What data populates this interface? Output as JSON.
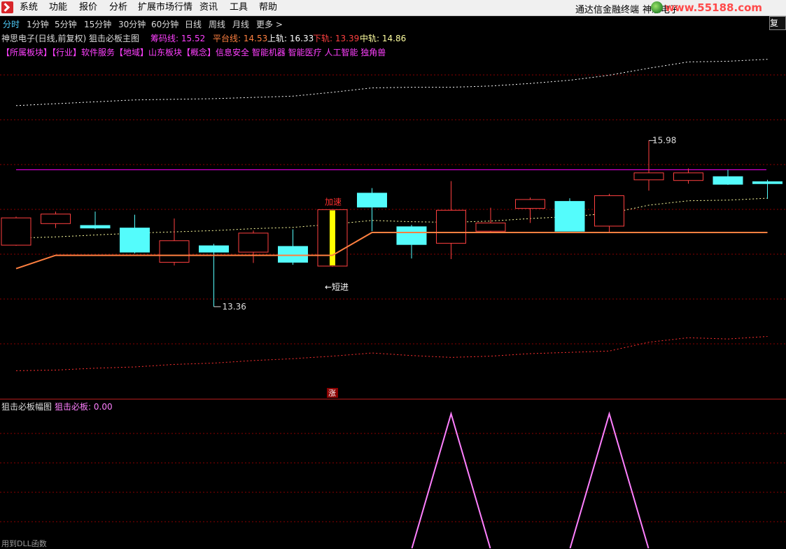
{
  "menu": {
    "items": [
      "系统",
      "功能",
      "报价",
      "分析",
      "扩展市场行情",
      "资讯",
      "工具",
      "帮助"
    ],
    "terminal_name": "通达信金融终端",
    "stock_name": "神思电子",
    "watermark": "www.55188.com"
  },
  "periods": {
    "tabs": [
      "分时",
      "1分钟",
      "5分钟",
      "15分钟",
      "30分钟",
      "60分钟",
      "日线",
      "周线",
      "月线",
      "更多 >"
    ],
    "active": "分时",
    "fuquan_label": "复权"
  },
  "main_title": {
    "stock": "神思电子(日线,前复权) 狙击必板主图",
    "chouma_label": "筹码线:",
    "chouma_value": "15.52",
    "pingtai_label": "平台线:",
    "pingtai_value": "14.53",
    "shangui_label": "上轨:",
    "shangui_value": "16.33",
    "xiagui_label": "下轨:",
    "xiagui_value": "13.39",
    "zhonggui_label": "中轨:",
    "zhonggui_value": "14.86"
  },
  "sectors": "【所属板块】【行业】软件服务【地域】山东板块【概念】信息安全 智能机器 智能医疗 人工智能 独角兽",
  "annotations": {
    "jiasu": "加速",
    "duanjin": "←短进",
    "high_label": "15.98",
    "low_label": "13.36",
    "zhang": "涨"
  },
  "sub_title": {
    "name": "狙击必板幅图",
    "label": "狙击必板:",
    "value": "0.00"
  },
  "bottom_text": "用到DLL函数",
  "colors": {
    "up": "#ff4040",
    "down": "#54fcfc",
    "platform": "#ff8040",
    "chip_line": "#ff00ff",
    "highlight": "#ffff00",
    "sub_line": "#ff80ff",
    "grid": "#8b0000"
  },
  "chart_data": {
    "type": "candlestick",
    "candles": [
      {
        "o": 14.33,
        "c": 14.76,
        "h": 14.78,
        "l": 14.32
      },
      {
        "o": 14.67,
        "c": 14.82,
        "h": 14.86,
        "l": 14.6
      },
      {
        "o": 14.64,
        "c": 14.6,
        "h": 14.86,
        "l": 14.58
      },
      {
        "o": 14.6,
        "c": 14.22,
        "h": 14.81,
        "l": 14.2
      },
      {
        "o": 14.06,
        "c": 14.4,
        "h": 14.75,
        "l": 14.01
      },
      {
        "o": 14.32,
        "c": 14.22,
        "h": 14.35,
        "l": 13.36
      },
      {
        "o": 14.22,
        "c": 14.52,
        "h": 14.56,
        "l": 14.05
      },
      {
        "o": 14.31,
        "c": 14.06,
        "h": 14.58,
        "l": 14.02
      },
      {
        "o": 14.0,
        "c": 14.89,
        "h": 14.9,
        "l": 13.99
      },
      {
        "o": 15.15,
        "c": 14.93,
        "h": 15.23,
        "l": 14.55
      },
      {
        "o": 14.62,
        "c": 14.34,
        "h": 14.65,
        "l": 14.12
      },
      {
        "o": 14.36,
        "c": 14.88,
        "h": 15.34,
        "l": 14.11
      },
      {
        "o": 14.55,
        "c": 14.68,
        "h": 14.92,
        "l": 14.54
      },
      {
        "o": 14.91,
        "c": 15.05,
        "h": 15.08,
        "l": 14.68
      },
      {
        "o": 15.02,
        "c": 14.55,
        "h": 15.07,
        "l": 14.55
      },
      {
        "o": 14.63,
        "c": 15.11,
        "h": 15.14,
        "l": 14.54
      },
      {
        "o": 15.36,
        "c": 15.47,
        "h": 15.98,
        "l": 15.19
      },
      {
        "o": 15.35,
        "c": 15.47,
        "h": 15.54,
        "l": 15.3
      },
      {
        "o": 15.41,
        "c": 15.29,
        "h": 15.52,
        "l": 15.28
      },
      {
        "o": 15.33,
        "c": 15.3,
        "h": 15.36,
        "l": 15.06
      }
    ],
    "signal_index": 8,
    "platform_line": [
      13.96,
      14.17,
      14.17,
      14.17,
      14.17,
      14.17,
      14.17,
      14.17,
      14.17,
      14.53,
      14.53,
      14.53,
      14.53,
      14.53,
      14.53,
      14.53,
      14.53,
      14.53,
      14.53,
      14.53
    ],
    "zhonggui_line": [
      14.44,
      14.46,
      14.49,
      14.52,
      14.54,
      14.56,
      14.59,
      14.61,
      14.66,
      14.72,
      14.7,
      14.69,
      14.71,
      14.75,
      14.78,
      14.83,
      14.96,
      15.03,
      15.04,
      15.07
    ],
    "shangui_line": [
      16.53,
      16.56,
      16.59,
      16.62,
      16.63,
      16.64,
      16.66,
      16.68,
      16.74,
      16.81,
      16.82,
      16.82,
      16.84,
      16.88,
      16.93,
      17.01,
      17.12,
      17.22,
      17.23,
      17.26
    ],
    "xiagui_line": [
      12.35,
      12.36,
      12.39,
      12.41,
      12.45,
      12.47,
      12.51,
      12.54,
      12.58,
      12.63,
      12.59,
      12.56,
      12.58,
      12.62,
      12.64,
      12.66,
      12.8,
      12.87,
      12.85,
      12.89
    ],
    "chip_level": 15.52,
    "ylim": [
      12.2,
      17.5
    ],
    "sub": {
      "values": [
        0,
        0,
        0,
        0,
        0,
        0,
        0,
        0,
        0,
        0,
        0,
        1,
        0,
        0,
        0,
        1,
        0,
        0,
        0,
        0
      ]
    }
  }
}
